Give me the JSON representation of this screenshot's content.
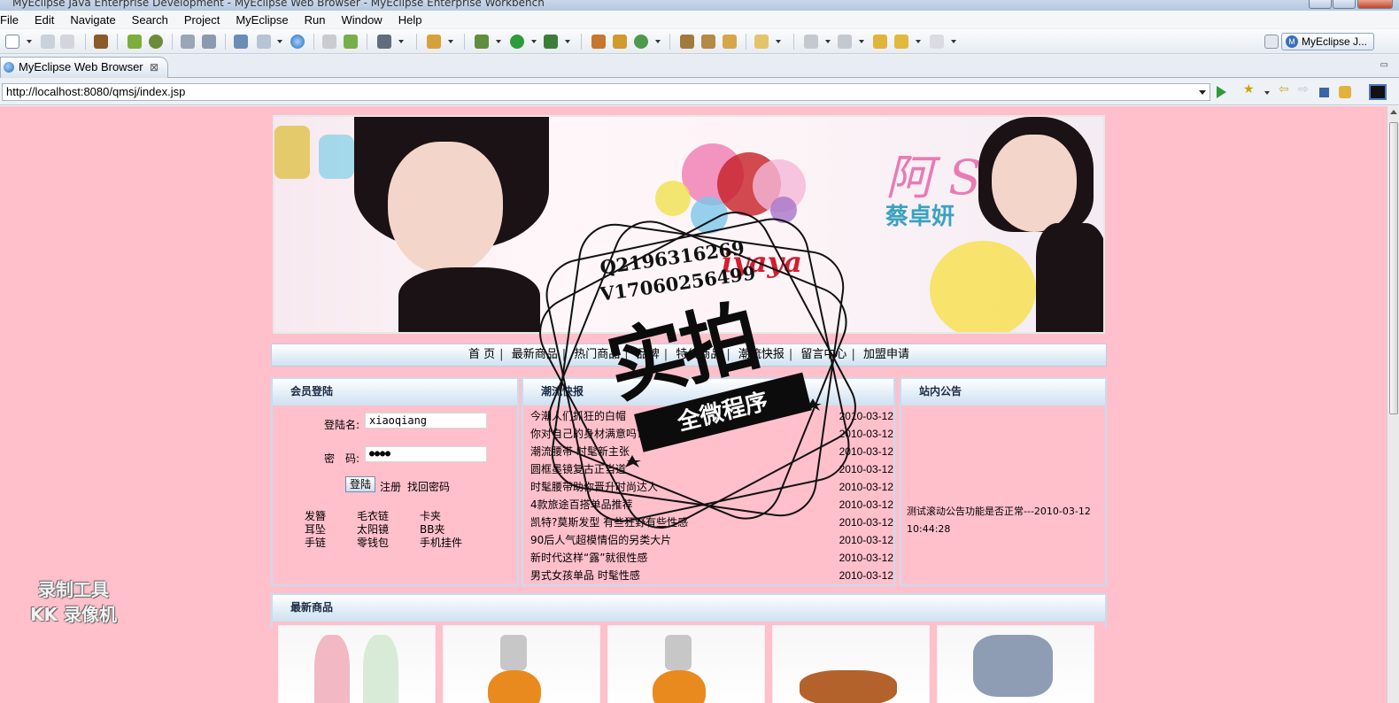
{
  "window": {
    "title": "MyEclipse Java Enterprise Development - MyEclipse Web Browser - MyEclipse Enterprise Workbench"
  },
  "menu": [
    "File",
    "Edit",
    "Navigate",
    "Search",
    "Project",
    "MyEclipse",
    "Run",
    "Window",
    "Help"
  ],
  "perspective": {
    "label": "MyEclipse J..."
  },
  "editor_tab": {
    "label": "MyEclipse Web Browser"
  },
  "address": {
    "url": "http://localhost:8080/qmsj/index.jsp"
  },
  "site": {
    "banner": {
      "sa_text": "阿 Sa",
      "name_text": "蔡卓妍",
      "brand_text": "iyaya"
    },
    "nav": [
      "首 页",
      "最新商品",
      "热门商品",
      "品牌",
      "特价商品",
      "潮流快报",
      "留言中心",
      "加盟申请"
    ],
    "login": {
      "title": "会员登陆",
      "username_label": "登陆名:",
      "username_value": "xiaoqiang",
      "password_label": "密　码:",
      "password_value": "●●●●",
      "login_button": "登陆",
      "register_link": "注册",
      "forgot_link": "找回密码",
      "categories": [
        "发簪",
        "毛衣链",
        "卡夹",
        "耳坠",
        "太阳镜",
        "BB夹",
        "手链",
        "零钱包",
        "手机挂件"
      ]
    },
    "news": {
      "title": "潮流快报",
      "items": [
        {
          "title": "今潮人们抓狂的白帽",
          "date": "2010-03-12"
        },
        {
          "title": "你对自己的身材满意吗?",
          "date": "2010-03-12"
        },
        {
          "title": "潮流腰带 时髦新主张",
          "date": "2010-03-12"
        },
        {
          "title": "圆框墨镜复古正当道",
          "date": "2010-03-12"
        },
        {
          "title": "时髦腰带助你晋升时尚达人",
          "date": "2010-03-12"
        },
        {
          "title": "4款旅途百搭单品推荐",
          "date": "2010-03-12"
        },
        {
          "title": "凯特?莫斯发型 有些狂野有些性感",
          "date": "2010-03-12"
        },
        {
          "title": "90后人气超模情侣的另类大片",
          "date": "2010-03-12"
        },
        {
          "title": "新时代这样“露”就很性感",
          "date": "2010-03-12"
        },
        {
          "title": "男式女孩单品 时髦性感",
          "date": "2010-03-12"
        }
      ]
    },
    "notice": {
      "title": "站内公告",
      "text": "测试滚动公告功能是否正常---2010-03-12 10:44:28"
    },
    "new_products": {
      "title": "最新商品"
    }
  },
  "watermark": {
    "line1": "Q2196316269",
    "line2": "V17060256499",
    "big": "实拍",
    "ribbon": "全微程序"
  },
  "recorder": {
    "line1": "录制工具",
    "line2": "KK 录像机"
  }
}
